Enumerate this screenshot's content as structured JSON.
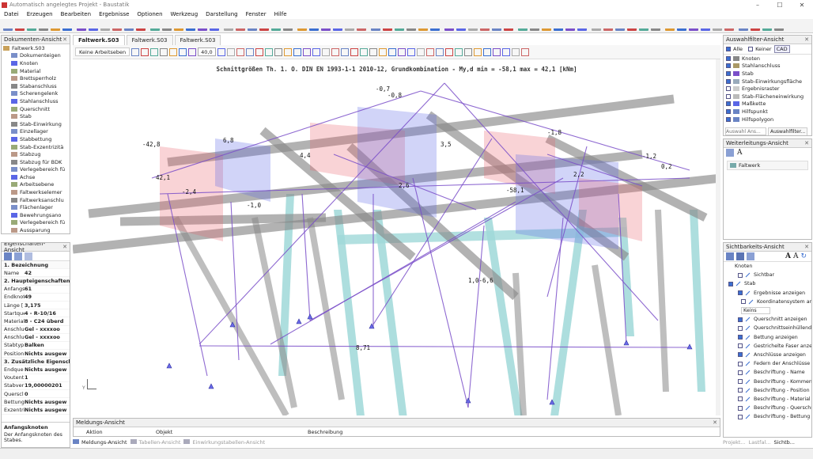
{
  "window": {
    "title": "Automatisch angelegtes Projekt - Baustatik"
  },
  "menu": [
    "Datei",
    "Erzeugen",
    "Bearbeiten",
    "Ergebnisse",
    "Optionen",
    "Werkzeug",
    "Darstellung",
    "Fenster",
    "Hilfe"
  ],
  "doc_panel": {
    "title": "Dokumenten-Ansicht",
    "root": "Faltwerk.S03",
    "items": [
      "Dokumenteigen",
      "Knoten",
      "Material",
      "Brettsperrholz",
      "Stabanschluss",
      "Scherengelenk",
      "Stahlanschluss",
      "Querschnitt",
      "Stab",
      "Stab-Einwirkung",
      "Einzellager",
      "Stabbettung",
      "Stab-Exzentrizitä",
      "Stabzug",
      "Stabzug für BDK",
      "Verlegebereich fü",
      "Achse",
      "Arbeitsebene",
      "Faltwerkselemer",
      "Faltwerksanschlu",
      "Flächenlager",
      "Bewehrungsano",
      "Verlegebereich fü",
      "Aussparung"
    ]
  },
  "props_panel": {
    "title": "Eigenschaften-Ansicht",
    "sections": [
      {
        "title": "1. Bezeichnung",
        "rows": [
          {
            "k": "Name",
            "v": "42"
          }
        ]
      },
      {
        "title": "2. Haupteigenschaften",
        "rows": [
          {
            "k": "Anfangs",
            "v": "61"
          },
          {
            "k": "Endknot",
            "v": "49"
          },
          {
            "k": "Länge [",
            "v": "3,175"
          },
          {
            "k": "Startque",
            "v": "4 - R-10/16"
          },
          {
            "k": "Material",
            "v": "8 - C24 überd"
          },
          {
            "k": "Anschlu",
            "v": "Gel - xxxxoo"
          },
          {
            "k": "Anschlu",
            "v": "Gel - xxxxoo"
          },
          {
            "k": "Stabtyp",
            "v": "Balken"
          },
          {
            "k": "Position",
            "v": "Nichts ausgew"
          }
        ]
      },
      {
        "title": "3. Zusätzliche Eigenscha",
        "rows": [
          {
            "k": "Endque",
            "v": "Nichts ausgew"
          },
          {
            "k": "Voutent",
            "v": "1"
          },
          {
            "k": "Stabver",
            "v": "19,00000201"
          },
          {
            "k": "Querscl",
            "v": "0"
          },
          {
            "k": "Bettung",
            "v": "Nichts ausgew"
          },
          {
            "k": "Exzentri",
            "v": "Nichts ausgew"
          }
        ]
      }
    ],
    "help_title": "Anfangsknoten",
    "help_text": "Der Anfangsknoten des Stabes."
  },
  "tabs": [
    "Faltwerk.S03",
    "Faltwerk.S03",
    "Faltwerk.S03"
  ],
  "viewbar": {
    "mode": "Keine Arbeitseben",
    "zoom": "40,0"
  },
  "viewport": {
    "title": "Schnittgrößen Th. 1. O. DIN EN 1993-1-1 2010-12, Grundkombination - My,d min = -58,1 max = 42,1 [kNm]",
    "labels": [
      "42,1",
      "-58,1",
      "-42,8",
      "2,6",
      "-1,0",
      "1,0-6,6",
      "8,71",
      "-2,4",
      "4,4",
      "-0,7",
      "-0,8",
      "2,2",
      "-1,2",
      "0,2",
      "3,5",
      "6,8",
      "-1,8"
    ]
  },
  "filter_panel": {
    "title": "Auswahlfilter-Ansicht",
    "buttons": [
      "Alle",
      "Keiner",
      "CAD"
    ],
    "items": [
      {
        "label": "Knoten",
        "on": true
      },
      {
        "label": "Stahlanschluss",
        "on": true
      },
      {
        "label": "Stab",
        "on": true
      },
      {
        "label": "Stab-Einwirkungsfläche",
        "on": true
      },
      {
        "label": "Ergebnisraster",
        "on": false
      },
      {
        "label": "Stab-Flächeneinwirkung",
        "on": false
      },
      {
        "label": "Maßkette",
        "on": true
      },
      {
        "label": "Hilfspunkt",
        "on": true
      },
      {
        "label": "Hilfspolygon",
        "on": true
      }
    ],
    "search_placeholder": "Auswahl Ans...",
    "button_filter": "Auswahlfilter..."
  },
  "forward_panel": {
    "title": "Weiterleitungs-Ansicht",
    "item": "Faltwerk"
  },
  "visibility_panel": {
    "title": "Sichtbarkeits-Ansicht",
    "items": [
      "Knoten",
      "Sichtbar",
      "Stab",
      "Ergebnisse anzeigen",
      "Koordinatensystem anzeigen",
      "Keins",
      "Querschnitt anzeigen",
      "Querschnittseinhüllende",
      "Bettung anzeigen",
      "Gestrichelte Faser anzeig",
      "Anschlüsse anzeigen",
      "Federn der Anschlüsse s",
      "Beschriftung - Name",
      "Beschriftung - Kommenta",
      "Beschriftung - Position",
      "Beschriftung - Material",
      "Beschriftung - Querschni",
      "Beschriftung - Bettung"
    ]
  },
  "message_panel": {
    "title": "Meldungs-Ansicht",
    "columns": [
      "Aktion",
      "Objekt",
      "Beschreibung"
    ]
  },
  "bottom_tabs": [
    "Meldungs-Ansicht",
    "Tabellen-Ansicht",
    "Einwirkungstabellen-Ansicht"
  ],
  "right_bottom_tabs": [
    "Projekt...",
    "Lastfal...",
    "Sichtb..."
  ],
  "colors": {
    "accent": "#3b6fd1",
    "beam_gray": "#8a8a8a",
    "column_cyan": "#9fd8d8",
    "member_purple": "#7b4fc9",
    "moment_red": "#e8606a",
    "moment_blue": "#5a66e6"
  }
}
